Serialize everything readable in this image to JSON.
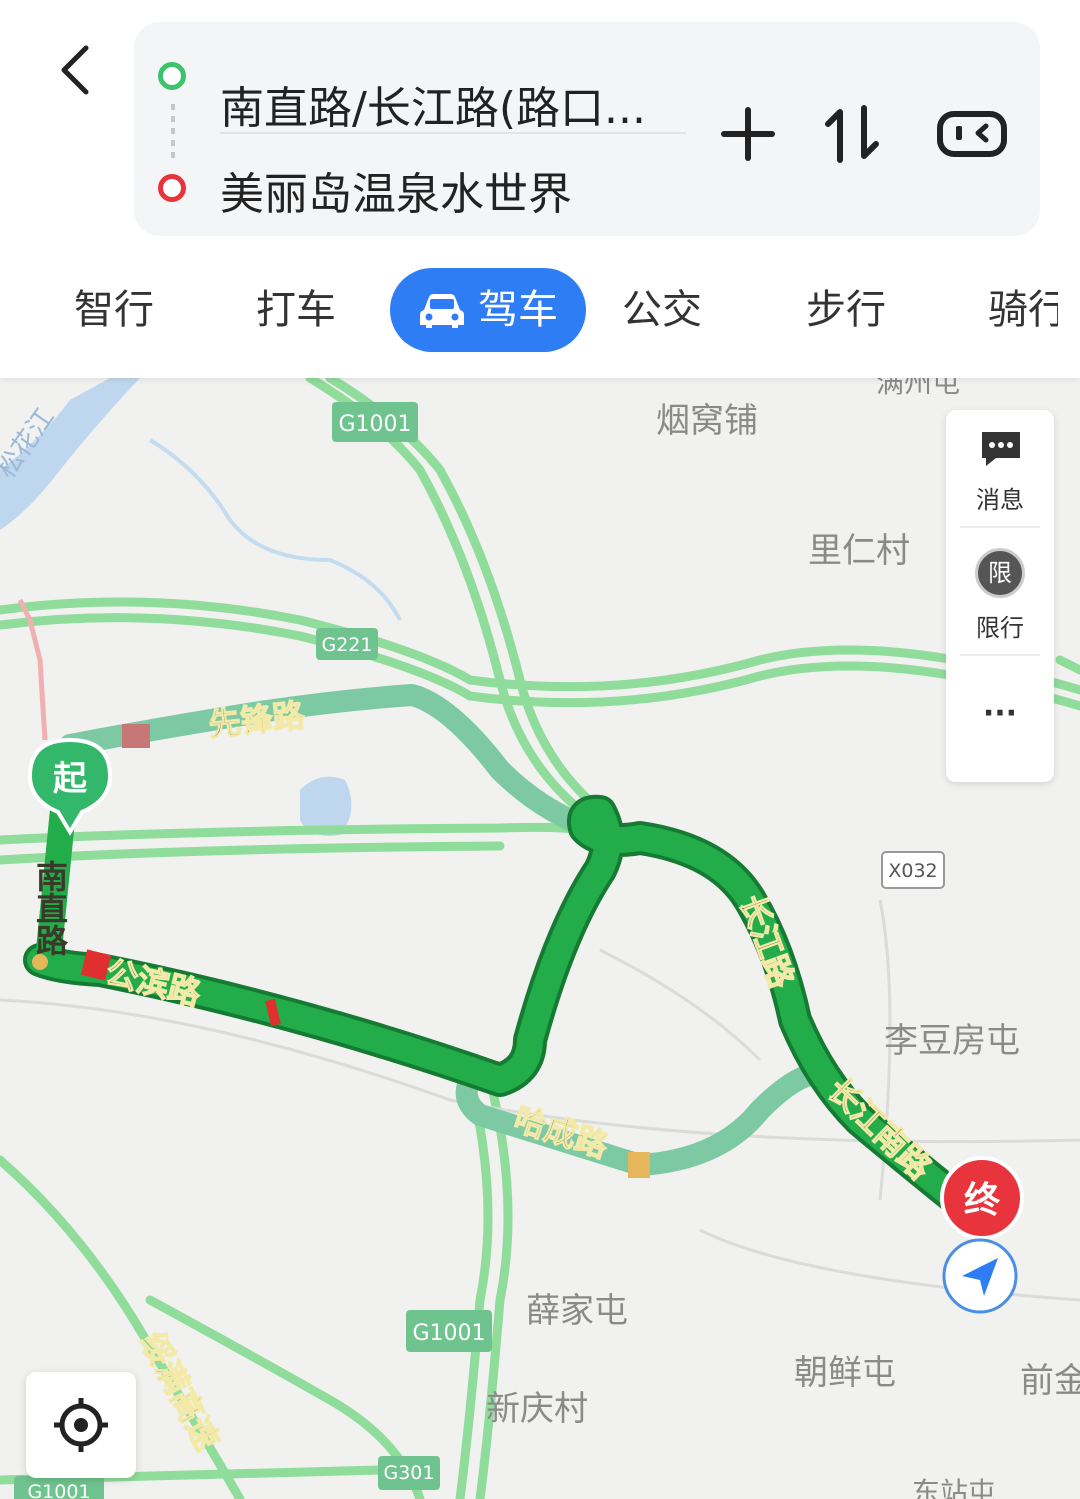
{
  "search": {
    "origin": "南直路/长江路(路口...",
    "destination": "美丽岛温泉水世界"
  },
  "tabs": [
    {
      "label": "智行"
    },
    {
      "label": "打车"
    },
    {
      "label": "驾车"
    },
    {
      "label": "公交"
    },
    {
      "label": "步行"
    },
    {
      "label": "骑行"
    }
  ],
  "map": {
    "place_labels": {
      "p1": "烟窝铺",
      "p2": "里仁村",
      "p3": "李豆房屯",
      "p4": "薛家屯",
      "p5": "朝鲜屯",
      "p6": "新庆村",
      "p7": "前金",
      "p8": "满州屯",
      "p9": "东站屯"
    },
    "road_labels": {
      "r1": "先锋路",
      "r2": "南直路",
      "r3": "公滨路",
      "r4": "长江路",
      "r5": "长江南路",
      "r6": "哈成路",
      "r7": "绥满高速",
      "r8": "松花江"
    },
    "shields": {
      "s1": "G1001",
      "s2": "G221",
      "s3": "X032",
      "s4": "G1001",
      "s5": "G301",
      "s6": "G1001"
    },
    "start_marker": "起",
    "end_marker": "终"
  },
  "side": {
    "message": "消息",
    "restriction_icon": "限",
    "restriction": "限行",
    "more": "···"
  },
  "colors": {
    "accent": "#2f7df5",
    "route_green": "#22ad4a",
    "alt_route": "#7cc9a4",
    "congested": "#e02f2f",
    "origin_dot": "#3cc46d",
    "dest_dot": "#e8353d"
  }
}
